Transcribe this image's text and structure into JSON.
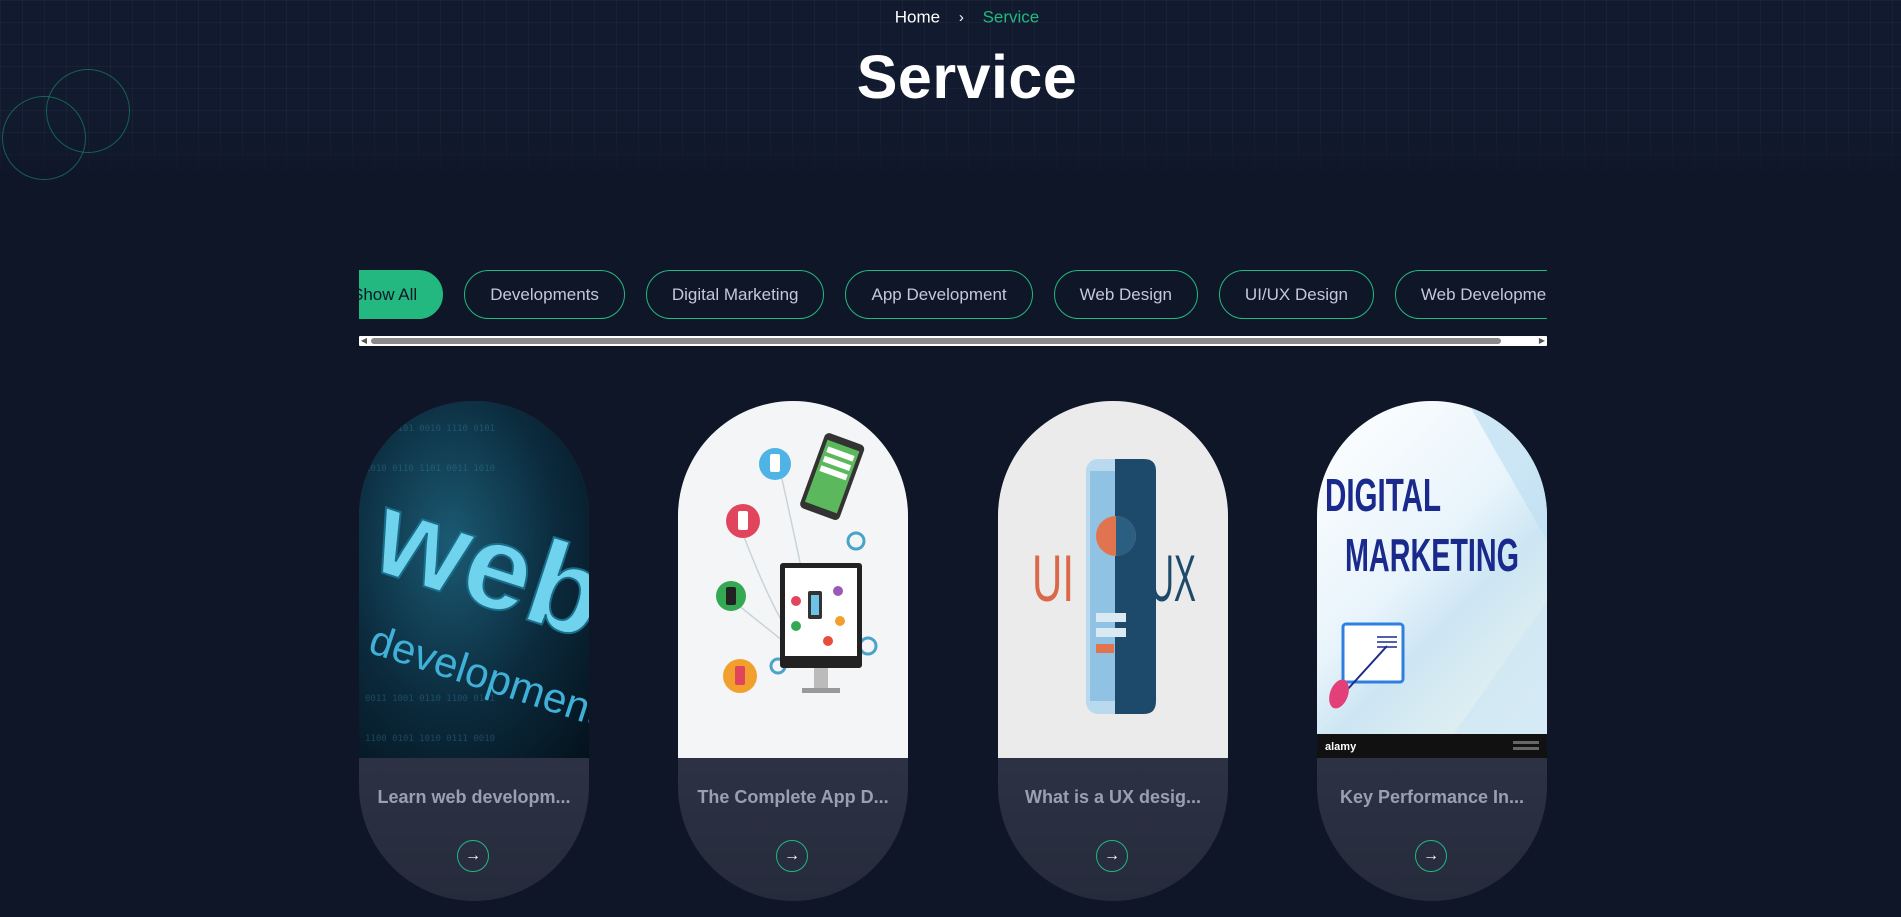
{
  "breadcrumb": {
    "home": "Home",
    "separator": "›",
    "current": "Service"
  },
  "page_title": "Service",
  "filters": [
    {
      "label": "Show All",
      "active": true
    },
    {
      "label": "Developments",
      "active": false
    },
    {
      "label": "Digital Marketing",
      "active": false
    },
    {
      "label": "App Development",
      "active": false
    },
    {
      "label": "Web Design",
      "active": false
    },
    {
      "label": "UI/UX Design",
      "active": false
    },
    {
      "label": "Web Development",
      "active": false
    }
  ],
  "cards": [
    {
      "title": "Learn web developm...",
      "image": "web-development-image",
      "arrow": "→"
    },
    {
      "title": "The Complete App D...",
      "image": "app-development-image",
      "arrow": "→"
    },
    {
      "title": "What is a UX desig...",
      "image": "ui-ux-image",
      "arrow": "→"
    },
    {
      "title": "Key Performance In...",
      "image": "digital-marketing-image",
      "arrow": "→"
    }
  ],
  "images": {
    "web_dev": {
      "line1": "web",
      "line2": "development"
    },
    "uiux": {
      "left": "UI",
      "right": "UX"
    },
    "marketing": {
      "line1": "DIGITAL",
      "line2": "MARKETING",
      "footer": "alamy"
    }
  },
  "colors": {
    "background": "#0f1628",
    "accent": "#22b87f",
    "card_bottom": "#3d4356"
  }
}
